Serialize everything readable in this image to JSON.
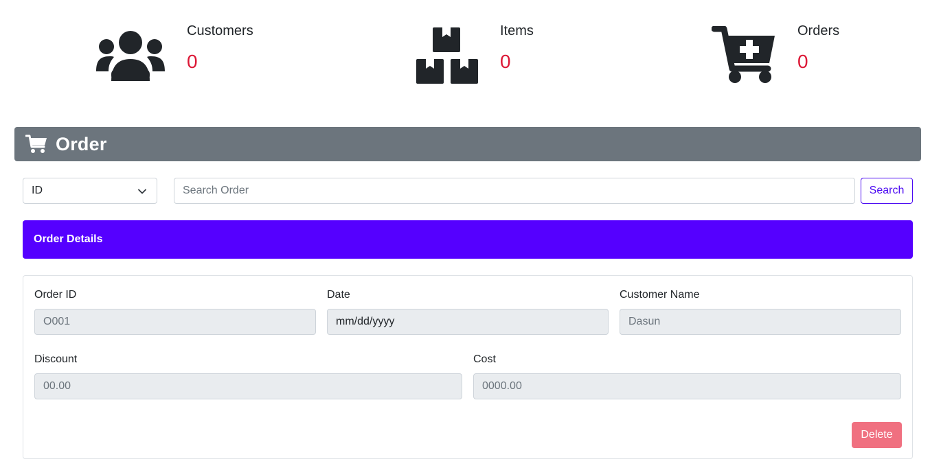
{
  "stats": {
    "customers": {
      "label": "Customers",
      "value": "0",
      "icon": "users-icon"
    },
    "items": {
      "label": "Items",
      "value": "0",
      "icon": "boxes-icon"
    },
    "orders": {
      "label": "Orders",
      "value": "0",
      "icon": "cart-plus-icon"
    }
  },
  "section": {
    "title": "Order",
    "icon": "shopping-cart-icon"
  },
  "search": {
    "filter_value": "ID",
    "placeholder": "Search Order",
    "button_label": "Search"
  },
  "details": {
    "title": "Order Details",
    "fields": {
      "order_id": {
        "label": "Order ID",
        "value": "O001"
      },
      "date": {
        "label": "Date",
        "value": "mm/dd/yyyy"
      },
      "customer_name": {
        "label": "Customer Name",
        "value": "Dasun"
      },
      "discount": {
        "label": "Discount",
        "value": "00.00"
      },
      "cost": {
        "label": "Cost",
        "value": "0000.00"
      }
    },
    "delete_label": "Delete"
  },
  "colors": {
    "accent": "#5500ff",
    "header_bg": "#6c757d",
    "stat_value": "#dc1836",
    "delete_bg": "#f07080"
  }
}
